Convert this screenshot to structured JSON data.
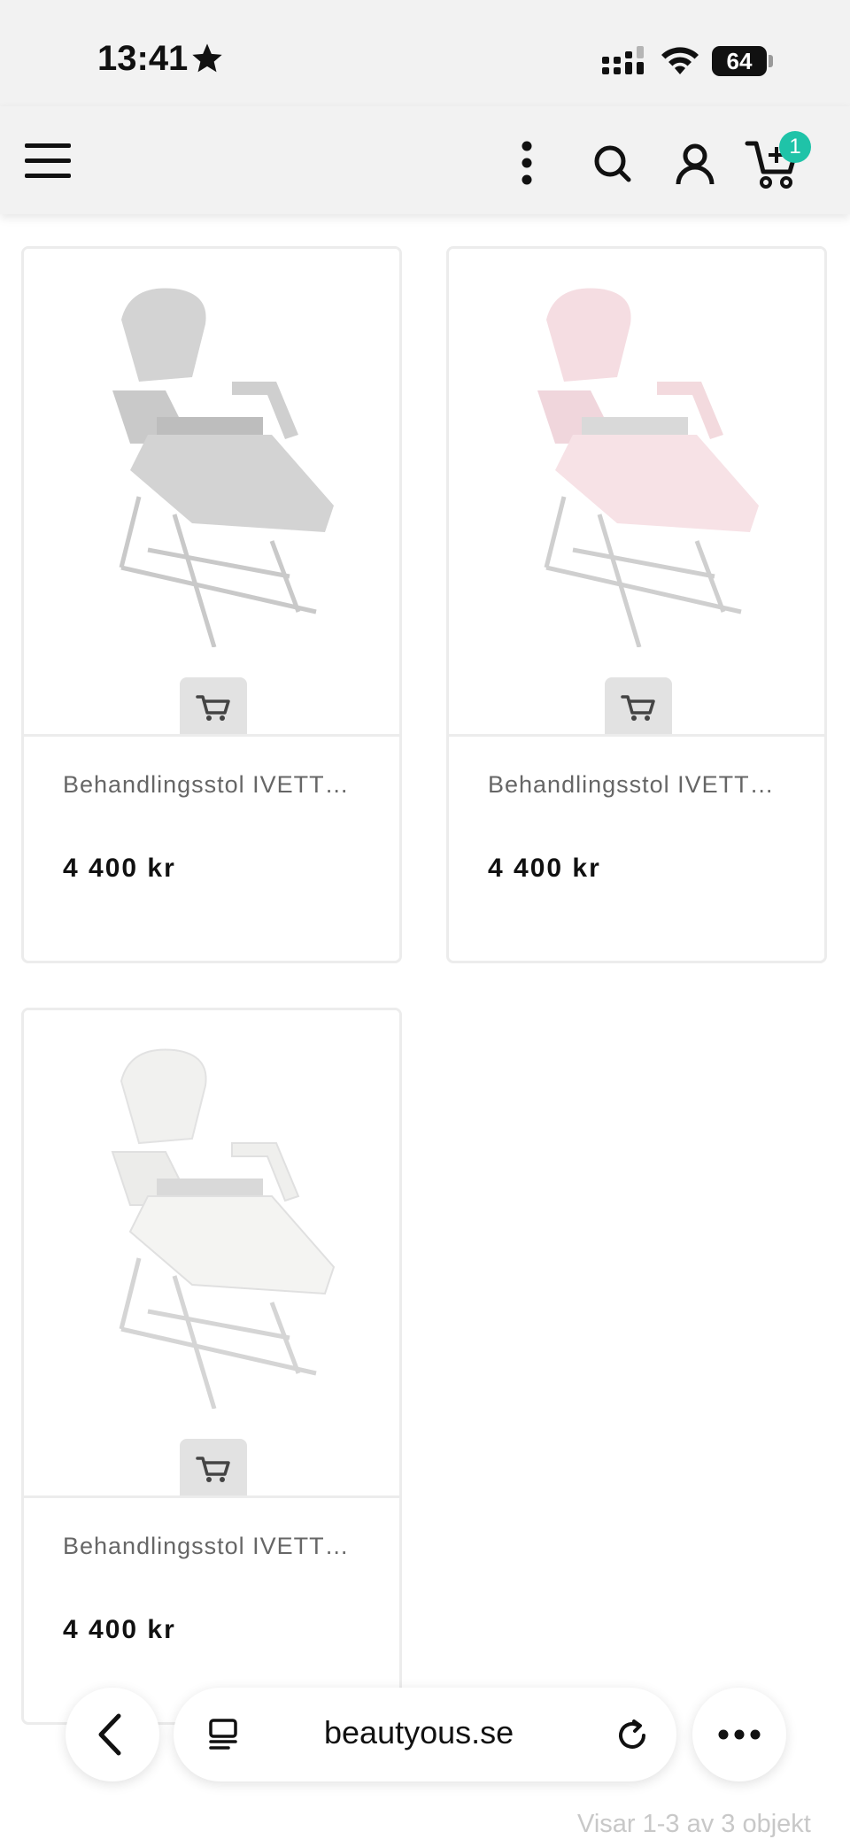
{
  "status_bar": {
    "time": "13:41",
    "battery": "64",
    "icons": [
      "star-icon",
      "signal-icon",
      "wifi-icon",
      "battery-icon"
    ]
  },
  "header": {
    "icons": [
      "menu-icon",
      "more-vertical-icon",
      "search-icon",
      "user-icon",
      "cart-icon"
    ],
    "cart_count": "1",
    "accent_color": "#1fc3a8"
  },
  "products": [
    {
      "name": "Behandlingsstol IVETT…",
      "price": "4 400 kr",
      "color": "#d3d3d3"
    },
    {
      "name": "Behandlingsstol IVETT…",
      "price": "4 400 kr",
      "color": "#f5dde2"
    },
    {
      "name": "Behandlingsstol IVETT…",
      "price": "4 400 kr",
      "color": "#f1f1ef"
    }
  ],
  "browser": {
    "url": "beautyous.se",
    "icons": [
      "back-icon",
      "tabs-icon",
      "reload-icon",
      "more-horizontal-icon"
    ]
  },
  "footer": {
    "result_count": "Visar 1-3 av 3 objekt"
  }
}
